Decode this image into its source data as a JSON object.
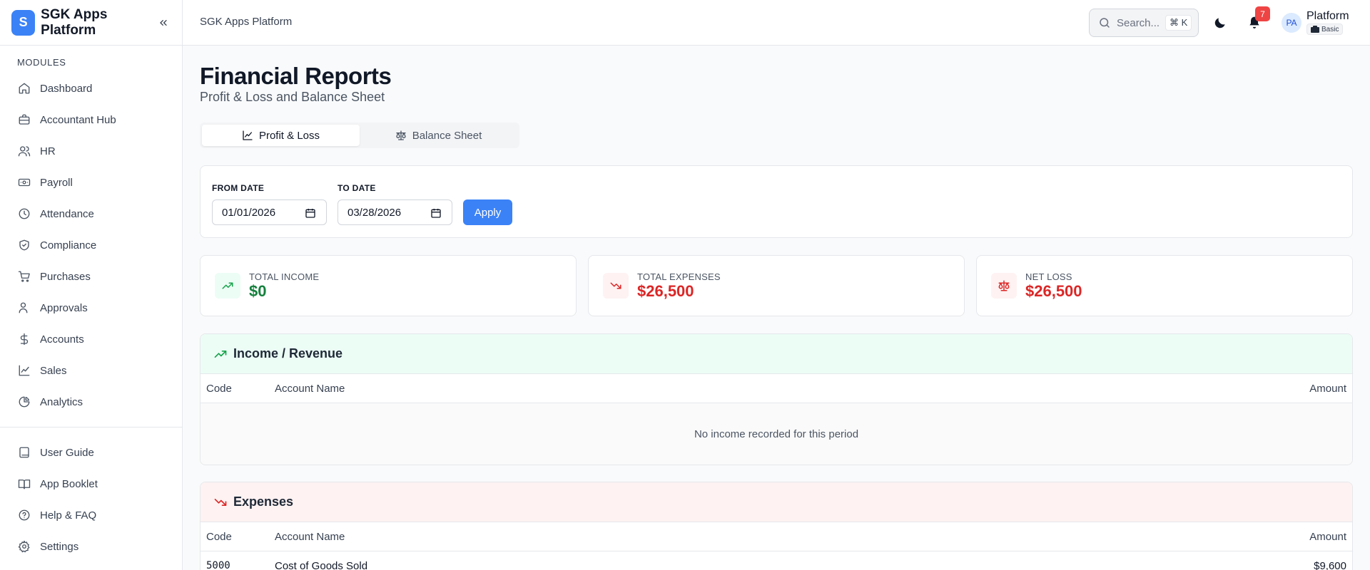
{
  "sidebar": {
    "brand_letter": "S",
    "brand_name": "SGK Apps Platform",
    "section_label": "MODULES",
    "items": [
      {
        "label": "Dashboard",
        "icon": "home-icon"
      },
      {
        "label": "Accountant Hub",
        "icon": "briefcase-icon"
      },
      {
        "label": "HR",
        "icon": "users-icon"
      },
      {
        "label": "Payroll",
        "icon": "banknote-icon"
      },
      {
        "label": "Attendance",
        "icon": "clock-icon"
      },
      {
        "label": "Compliance",
        "icon": "shield-check-icon"
      },
      {
        "label": "Purchases",
        "icon": "cart-icon"
      },
      {
        "label": "Approvals",
        "icon": "user-check-icon"
      },
      {
        "label": "Accounts",
        "icon": "dollar-icon"
      },
      {
        "label": "Sales",
        "icon": "trending-up-icon"
      },
      {
        "label": "Analytics",
        "icon": "pie-chart-icon"
      }
    ],
    "bottom_items": [
      {
        "label": "User Guide",
        "icon": "book-icon"
      },
      {
        "label": "App Booklet",
        "icon": "book-open-icon"
      },
      {
        "label": "Help & FAQ",
        "icon": "help-circle-icon"
      },
      {
        "label": "Settings",
        "icon": "gear-icon"
      }
    ]
  },
  "topbar": {
    "breadcrumb": "SGK Apps Platform",
    "search_placeholder": "Search...",
    "search_shortcut": "⌘ K",
    "notification_count": "7",
    "avatar_initials": "PA",
    "user_name": "Platform",
    "plan_label": "Basic"
  },
  "page": {
    "title": "Financial Reports",
    "subtitle": "Profit & Loss and Balance Sheet",
    "tabs": [
      {
        "label": "Profit & Loss",
        "active": true
      },
      {
        "label": "Balance Sheet",
        "active": false
      }
    ],
    "filters": {
      "from_label": "FROM DATE",
      "from_value": "01/01/2026",
      "to_label": "TO DATE",
      "to_value": "03/28/2026",
      "apply_label": "Apply"
    },
    "stats": {
      "income": {
        "label": "TOTAL INCOME",
        "value": "$0",
        "color": "#15803d"
      },
      "expenses": {
        "label": "TOTAL EXPENSES",
        "value": "$26,500",
        "color": "#dc2626"
      },
      "net": {
        "label": "NET LOSS",
        "value": "$26,500",
        "color": "#dc2626"
      }
    },
    "income_section": {
      "title": "Income / Revenue",
      "columns": {
        "code": "Code",
        "name": "Account Name",
        "amount": "Amount"
      },
      "empty_text": "No income recorded for this period"
    },
    "expenses_section": {
      "title": "Expenses",
      "columns": {
        "code": "Code",
        "name": "Account Name",
        "amount": "Amount"
      },
      "rows": [
        {
          "code": "5000",
          "name": "Cost of Goods Sold",
          "amount": "$9,600"
        }
      ]
    }
  },
  "colors": {
    "accent": "#3b82f6",
    "income_bg": "#ecfdf5",
    "expense_bg": "#fef2f2",
    "positive": "#16a34a",
    "negative": "#dc2626"
  }
}
